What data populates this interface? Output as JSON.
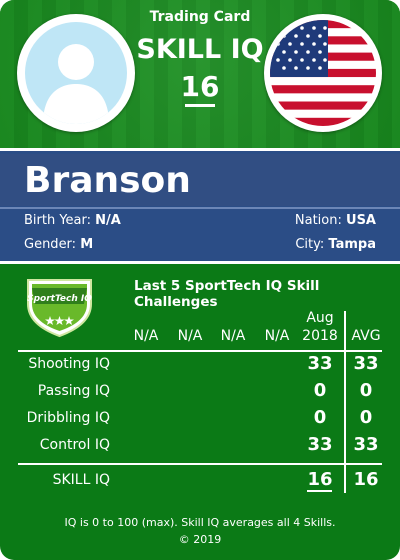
{
  "header": {
    "title": "Trading Card",
    "skill_label": "SKILL IQ",
    "skill_value": "16"
  },
  "player": {
    "name": "Branson",
    "birth_year_label": "Birth Year:",
    "birth_year": "N/A",
    "gender_label": "Gender:",
    "gender": "M",
    "nation_label": "Nation:",
    "nation": "USA",
    "city_label": "City:",
    "city": "Tampa"
  },
  "logo": {
    "text": "SportTech IQ"
  },
  "challenges": {
    "title": "Last 5 SportTech IQ Skill Challenges",
    "columns": [
      "N/A",
      "N/A",
      "N/A",
      "N/A"
    ],
    "aug_col_month": "Aug",
    "aug_col_year": "2018",
    "avg_col": "AVG",
    "rows": [
      {
        "label": "Shooting IQ",
        "aug": "33",
        "avg": "33"
      },
      {
        "label": "Passing IQ",
        "aug": "0",
        "avg": "0"
      },
      {
        "label": "Dribbling IQ",
        "aug": "0",
        "avg": "0"
      },
      {
        "label": "Control IQ",
        "aug": "33",
        "avg": "33"
      }
    ],
    "total": {
      "label": "SKILL IQ",
      "aug": "16",
      "avg": "16"
    }
  },
  "footer": {
    "note": "IQ is 0 to 100 (max). Skill IQ averages all 4 Skills.",
    "copyright": "© 2019"
  },
  "colors": {
    "grass": "#0b7a16",
    "band_blue": "#2b4d86",
    "flag_red": "#c8102e",
    "flag_blue": "#1f3a7a"
  }
}
